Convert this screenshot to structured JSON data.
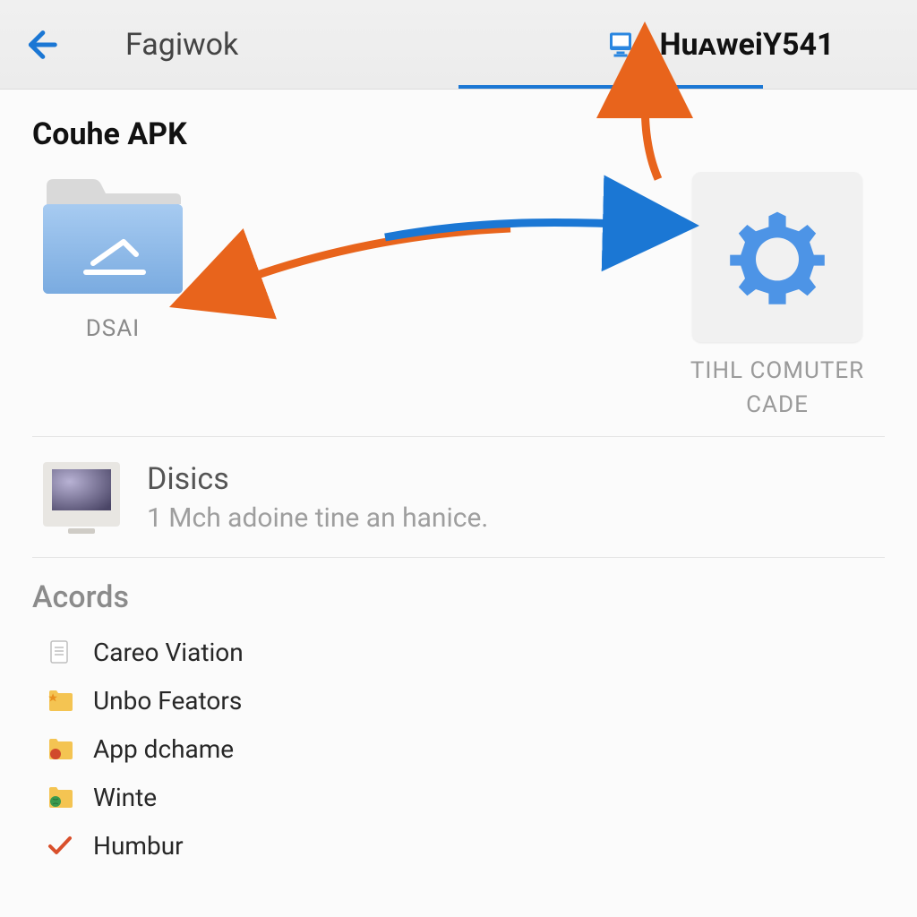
{
  "header": {
    "tab_left": "Fagiwok",
    "tab_right": "HuᴀweiY541"
  },
  "main": {
    "title": "Couhe APK",
    "folder_label": "DSAI",
    "settings_caption": "TIHL COMUTER CADE",
    "disics": {
      "title": "Disics",
      "subtitle": "1 Mch adoine tine an hanice."
    },
    "acords_title": "Acords",
    "acords": [
      {
        "label": "Careo Viation",
        "icon": "document"
      },
      {
        "label": "Unbo Feators",
        "icon": "folder-star"
      },
      {
        "label": "App dchame",
        "icon": "folder-red"
      },
      {
        "label": "Winte",
        "icon": "folder-globe"
      },
      {
        "label": "Humbur",
        "icon": "check"
      }
    ]
  },
  "colors": {
    "accent": "#1b77d4",
    "orange": "#e8641c"
  }
}
